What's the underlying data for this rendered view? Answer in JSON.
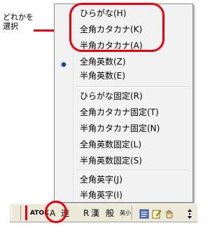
{
  "callout": {
    "line1": "どれかを",
    "line2": "選択"
  },
  "menu": {
    "selected_index": 3,
    "items": [
      "ひらがな(H)",
      "全角カタカナ(K)",
      "半角カタカナ(A)",
      "全角英数(Z)",
      "半角英数(E)",
      "ひらがな固定(R)",
      "全角カタカナ固定(T)",
      "半角カタカナ固定(N)",
      "全角英数固定(L)",
      "半角英数固定(S)",
      "全角英字(J)",
      "半角英字(I)"
    ]
  },
  "toolbar": {
    "atok_label": "ATOK",
    "mode_label": "A",
    "ren_label": "連",
    "r_label": "R",
    "kan_label": "漢",
    "han_label": "般",
    "eisho_label": "英小",
    "icons": [
      "dictionary-icon",
      "note-icon",
      "hand-icon",
      "arrow-icon"
    ],
    "accent": "#e60012"
  }
}
